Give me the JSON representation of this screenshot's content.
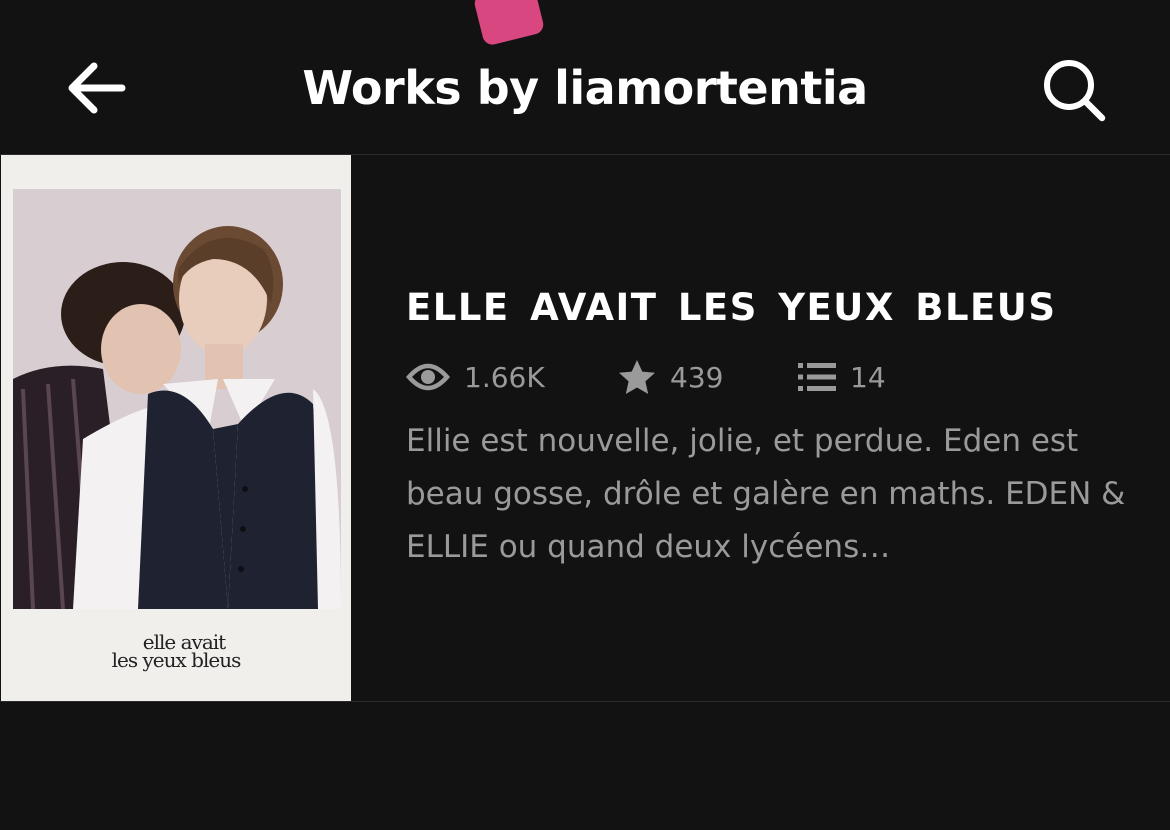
{
  "header": {
    "title": "Works by liamortentia",
    "back_icon": "arrow-left-icon",
    "search_icon": "search-icon"
  },
  "story": {
    "title": "ELLE AVAIT LES YEUX BLEUS",
    "reads": "1.66K",
    "votes": "439",
    "parts": "14",
    "description": "Ellie est nouvelle, jolie, et perdue. Eden est beau gosse, drôle et galère en maths. EDEN & ELLIE ou quand deux lycéens…",
    "cover": {
      "caption_line1": "elle avait",
      "caption_line2": "les yeux bleus"
    }
  },
  "colors": {
    "background": "#121212",
    "text_primary": "#ffffff",
    "text_secondary": "#9a9a9a",
    "divider": "#2c2c2c",
    "accent_pink": "#d8477f"
  }
}
